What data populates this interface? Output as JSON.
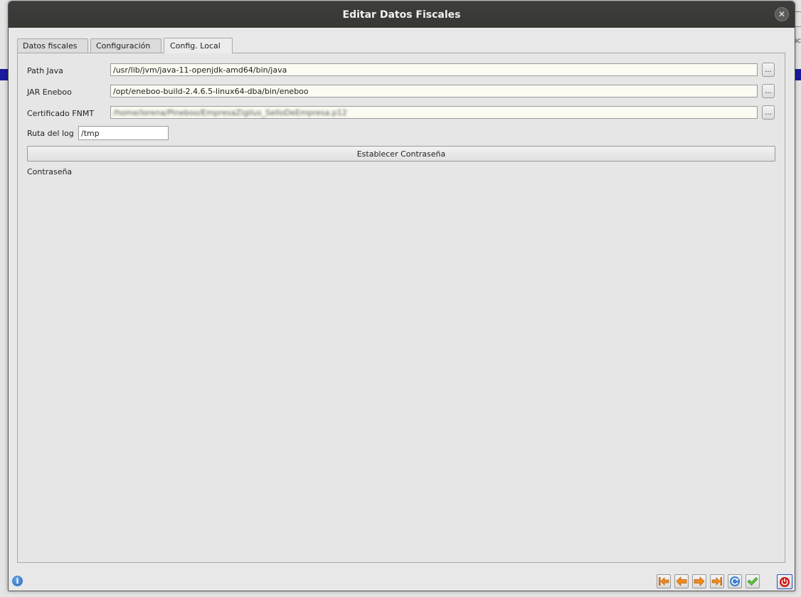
{
  "window": {
    "title": "Editar Datos Fiscales"
  },
  "tabs": [
    {
      "label": "Datos fiscales",
      "active": false
    },
    {
      "label": "Configuración",
      "active": false
    },
    {
      "label": "Config. Local",
      "active": true
    }
  ],
  "form": {
    "path_java": {
      "label": "Path Java",
      "value": "/usr/lib/jvm/java-11-openjdk-amd64/bin/java",
      "browse": "..."
    },
    "jar_eneboo": {
      "label": "JAR Eneboo",
      "value": "/opt/eneboo-build-2.4.6.5-linux64-dba/bin/eneboo",
      "browse": "..."
    },
    "certificado": {
      "label": "Certificado FNMT",
      "value": "/home/lorena/Pineboo/EmpresaZigilus_SelloDeEmpresa.p12",
      "browse": "..."
    },
    "ruta_log": {
      "label": "Ruta del log",
      "value": "/tmp"
    },
    "set_password_button": "Establecer Contraseña",
    "password_label": "Contraseña"
  },
  "background": {
    "right_edge_text": "uc"
  },
  "icons": {
    "close": "close-icon",
    "info": "info-icon",
    "first": "first-record-icon",
    "prev": "previous-record-icon",
    "next": "next-record-icon",
    "last": "last-record-icon",
    "refresh": "refresh-icon",
    "accept": "accept-check-icon",
    "exit": "power-icon"
  },
  "colors": {
    "titlebar": "#3a3a38",
    "nav_arrow": "#f08a1c",
    "accept": "#4caf32",
    "power": "#d01818",
    "info": "#2f78c8"
  }
}
